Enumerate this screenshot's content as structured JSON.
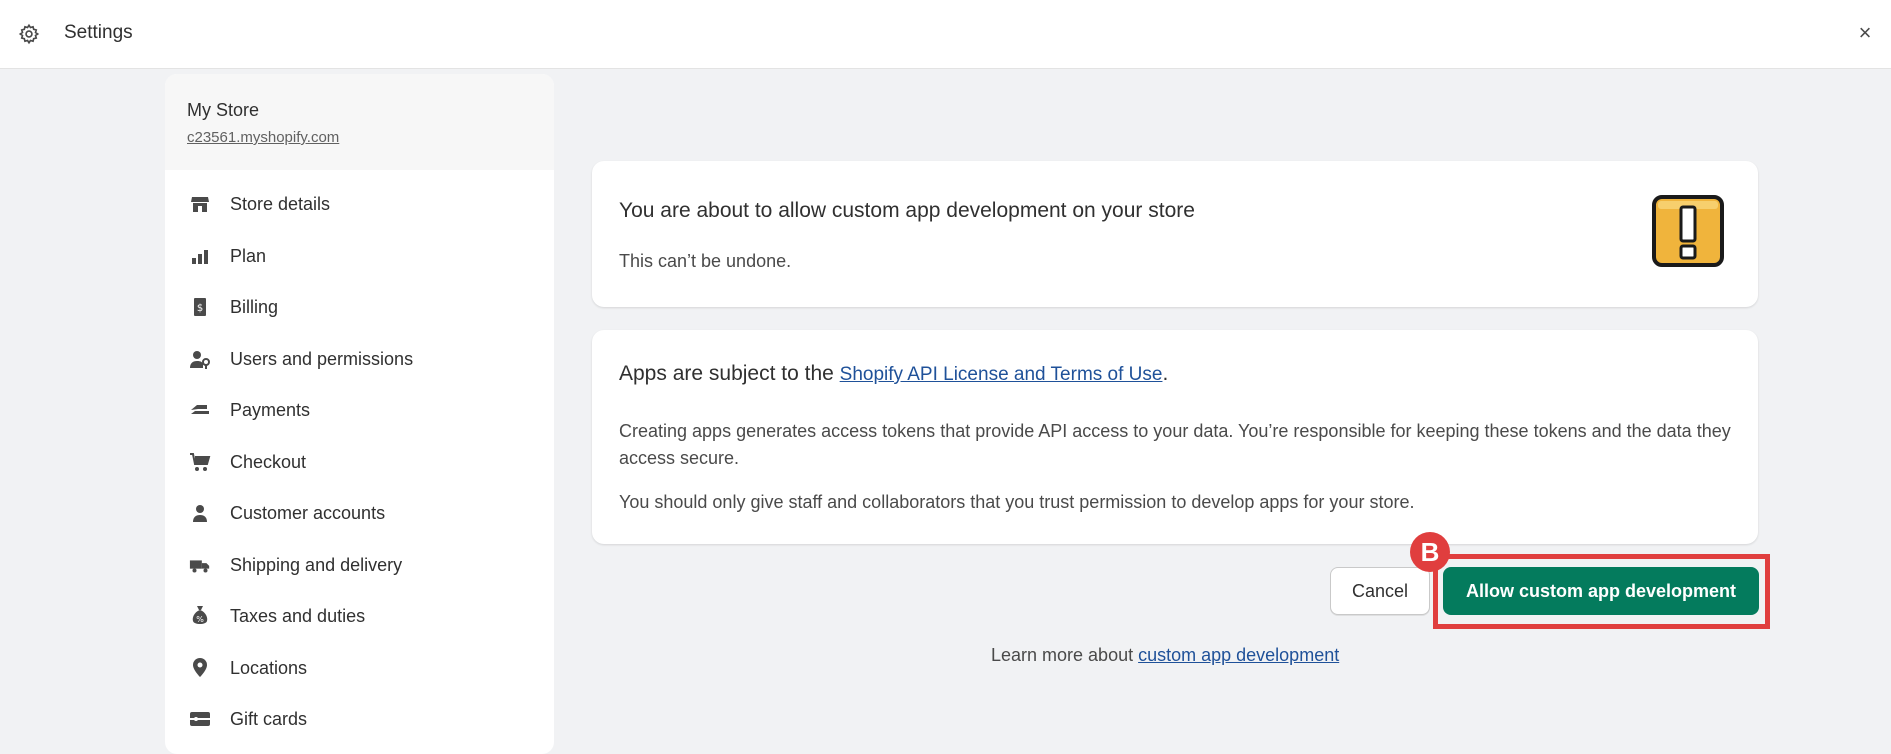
{
  "topbar": {
    "title": "Settings",
    "close_label": "×"
  },
  "store": {
    "name": "My Store",
    "url": "c23561.myshopify.com"
  },
  "sidebar": {
    "items": [
      {
        "label": "Store details",
        "icon": "store-icon"
      },
      {
        "label": "Plan",
        "icon": "plan-icon"
      },
      {
        "label": "Billing",
        "icon": "billing-icon"
      },
      {
        "label": "Users and permissions",
        "icon": "users-icon"
      },
      {
        "label": "Payments",
        "icon": "payments-icon"
      },
      {
        "label": "Checkout",
        "icon": "cart-icon"
      },
      {
        "label": "Customer accounts",
        "icon": "person-icon"
      },
      {
        "label": "Shipping and delivery",
        "icon": "truck-icon"
      },
      {
        "label": "Taxes and duties",
        "icon": "tax-icon"
      },
      {
        "label": "Locations",
        "icon": "location-pin-icon"
      },
      {
        "label": "Gift cards",
        "icon": "gift-card-icon"
      }
    ]
  },
  "warning_card": {
    "title": "You are about to allow custom app development on your store",
    "subtitle": "This can’t be undone.",
    "icon": "exclamation-icon"
  },
  "terms_card": {
    "title_prefix": "Apps are subject to the ",
    "link_text": "Shopify API License and Terms of Use",
    "title_suffix": ".",
    "paragraph1": "Creating apps generates access tokens that provide API access to your data. You’re responsible for keeping these tokens and the data they access secure.",
    "paragraph2": "You should only give staff and collaborators that you trust permission to develop apps for your store."
  },
  "actions": {
    "cancel_label": "Cancel",
    "allow_label": "Allow custom app development",
    "badge_label": "B"
  },
  "footer": {
    "learn_prefix": "Learn more about ",
    "learn_link": "custom app development"
  },
  "colors": {
    "primary": "#047b5d",
    "link": "#1f5199",
    "highlight": "#e03e3e",
    "warning": "#f0b43c"
  }
}
